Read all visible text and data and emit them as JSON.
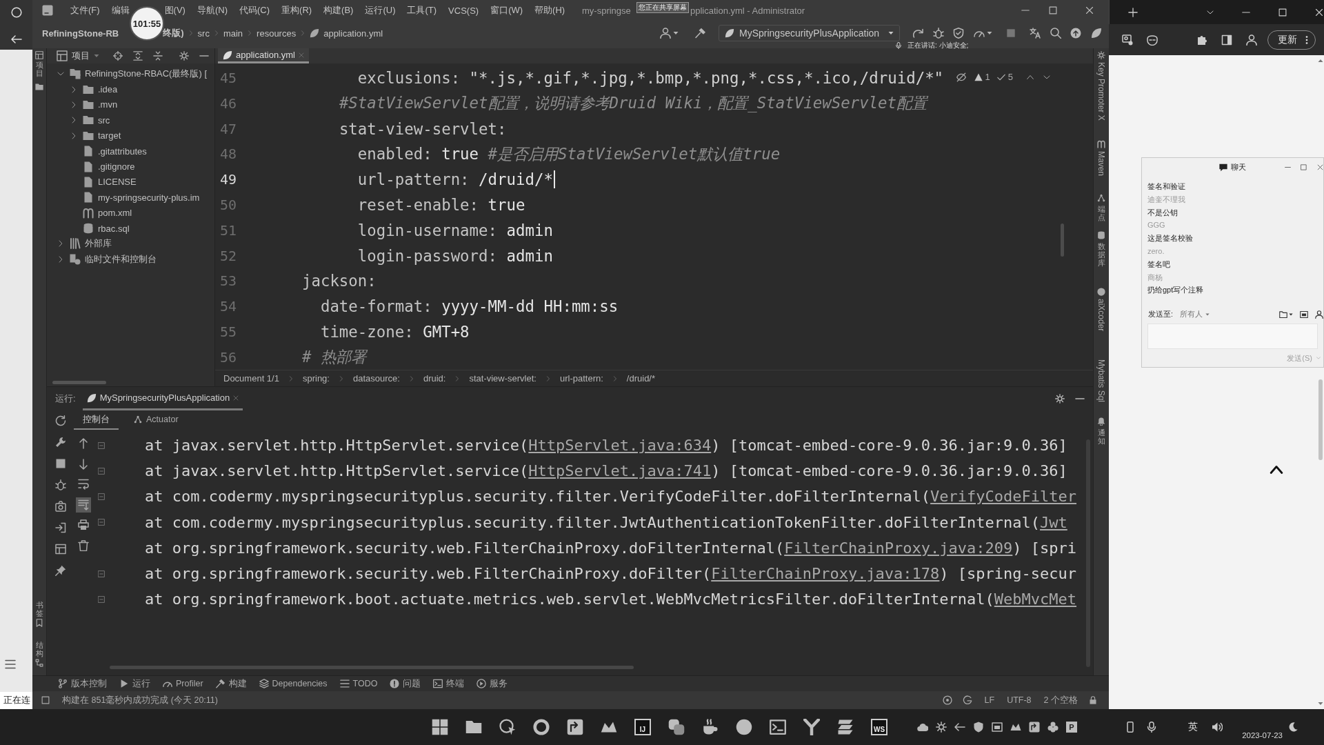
{
  "overlays": {
    "recording_timer": "101:55",
    "share_notice": "您正在共享屏幕",
    "speaking": "正在讲话: 小迪安全;"
  },
  "side_window": {
    "status": "正在连"
  },
  "ide": {
    "menu": [
      "文件(F)",
      "编辑",
      "图(V)",
      "导航(N)",
      "代码(C)",
      "重构(R)",
      "构建(B)",
      "运行(U)",
      "工具(T)",
      "VCS(S)",
      "窗口(W)",
      "帮助(H)"
    ],
    "title": [
      "my-springse",
      "pplication.yml - Administrator"
    ],
    "breadcrumbs": [
      "RefiningStone-RB",
      "终版)",
      "src",
      "main",
      "resources",
      "application.yml"
    ],
    "run_config": "MySpringsecurityPlusApplication",
    "left_strip": {
      "top": "项目",
      "bottom": [
        "书签",
        "结构"
      ]
    },
    "right_strip": [
      "Key Promoter X",
      "Maven",
      "端点",
      "数据库",
      "aiXcoder",
      "Mybatis Sql",
      "通知"
    ],
    "project": {
      "title": "项目",
      "tree": [
        {
          "label": "RefiningStone-RBAC(最终版) [",
          "kind": "module",
          "expanded": true,
          "children": [
            {
              "label": ".idea",
              "kind": "folder",
              "expanded": false
            },
            {
              "label": ".mvn",
              "kind": "folder",
              "expanded": false
            },
            {
              "label": "src",
              "kind": "folder",
              "expanded": false
            },
            {
              "label": "target",
              "kind": "folder",
              "expanded": false
            },
            {
              "label": ".gitattributes",
              "kind": "file"
            },
            {
              "label": ".gitignore",
              "kind": "file"
            },
            {
              "label": "LICENSE",
              "kind": "file"
            },
            {
              "label": "my-springsecurity-plus.im",
              "kind": "file"
            },
            {
              "label": "pom.xml",
              "kind": "maven"
            },
            {
              "label": "rbac.sql",
              "kind": "sql"
            }
          ]
        },
        {
          "label": "外部库",
          "kind": "library",
          "expanded": false
        },
        {
          "label": "临时文件和控制台",
          "kind": "scratch",
          "expanded": false
        }
      ]
    },
    "editor": {
      "tabs": [
        {
          "label": "application.yml",
          "selected": true
        }
      ],
      "inspections": {
        "warnings": "1",
        "checks": "5"
      },
      "lines": [
        {
          "number": "45",
          "current": false,
          "segs": [
            {
              "kind": "key",
              "text": "        exclusions:"
            },
            {
              "kind": "string",
              "text": " \"*.js,*.gif,*.jpg,*.bmp,*.png,*.css,*.ico,/druid/*\""
            }
          ]
        },
        {
          "number": "46",
          "current": false,
          "segs": [
            {
              "kind": "comment",
              "text": "      #StatViewServlet配置，说明请参考Druid Wiki，配置_StatViewServlet配置"
            }
          ]
        },
        {
          "number": "47",
          "current": false,
          "segs": [
            {
              "kind": "key",
              "text": "      stat-view-servlet:"
            }
          ]
        },
        {
          "number": "48",
          "current": false,
          "segs": [
            {
              "kind": "key",
              "text": "        enabled:"
            },
            {
              "kind": "value",
              "text": " true "
            },
            {
              "kind": "comment",
              "text": "#是否启用StatViewServlet默认值true"
            }
          ]
        },
        {
          "number": "49",
          "current": true,
          "segs": [
            {
              "kind": "key",
              "text": "        url-pattern:"
            },
            {
              "kind": "value",
              "text": " /druid/*"
            }
          ]
        },
        {
          "number": "50",
          "current": false,
          "segs": [
            {
              "kind": "key",
              "text": "        reset-enable:"
            },
            {
              "kind": "value",
              "text": " true"
            }
          ]
        },
        {
          "number": "51",
          "current": false,
          "segs": [
            {
              "kind": "key",
              "text": "        login-username:"
            },
            {
              "kind": "value",
              "text": " admin"
            }
          ]
        },
        {
          "number": "52",
          "current": false,
          "segs": [
            {
              "kind": "key",
              "text": "        login-password:"
            },
            {
              "kind": "value",
              "text": " admin"
            }
          ]
        },
        {
          "number": "53",
          "current": false,
          "segs": [
            {
              "kind": "key",
              "text": "  jackson:"
            }
          ]
        },
        {
          "number": "54",
          "current": false,
          "segs": [
            {
              "kind": "key",
              "text": "    date-format:"
            },
            {
              "kind": "value",
              "text": " yyyy-MM-dd HH:mm:ss"
            }
          ]
        },
        {
          "number": "55",
          "current": false,
          "segs": [
            {
              "kind": "key",
              "text": "    time-zone:"
            },
            {
              "kind": "value",
              "text": " GMT+8"
            }
          ]
        },
        {
          "number": "56",
          "current": false,
          "segs": [
            {
              "kind": "comment",
              "text": "  # 热部署"
            }
          ]
        }
      ],
      "path": [
        "Document 1/1",
        "spring:",
        "datasource:",
        "druid:",
        "stat-view-servlet:",
        "url-pattern:",
        "/druid/*"
      ]
    },
    "run": {
      "label": "运行:",
      "tabs": [
        {
          "label": "MySpringsecurityPlusApplication",
          "selected": true
        }
      ],
      "subtabs": [
        {
          "label": "控制台",
          "selected": true
        },
        {
          "label": "Actuator",
          "selected": false
        }
      ],
      "scroll_to_end": true,
      "console": [
        {
          "prefix": "at javax.servlet.http.HttpServlet.service(",
          "link": "HttpServlet.java:634",
          "suffix": ") [tomcat-embed-core-9.0.36.jar:9.0.36]",
          "marker": true
        },
        {
          "prefix": "at javax.servlet.http.HttpServlet.service(",
          "link": "HttpServlet.java:741",
          "suffix": ") [tomcat-embed-core-9.0.36.jar:9.0.36]",
          "marker": true
        },
        {
          "prefix": "at com.codermy.myspringsecurityplus.security.filter.VerifyCodeFilter.doFilterInternal(",
          "link": "VerifyCodeFilter",
          "marker": true
        },
        {
          "prefix": "at com.codermy.myspringsecurityplus.security.filter.JwtAuthenticationTokenFilter.doFilterInternal(",
          "link": "Jwt",
          "marker": true
        },
        {
          "prefix": "at org.springframework.security.web.FilterChainProxy.doFilterInternal(",
          "link": "FilterChainProxy.java:209",
          "suffix": ") [spri",
          "marker": false
        },
        {
          "prefix": "at org.springframework.security.web.FilterChainProxy.doFilter(",
          "link": "FilterChainProxy.java:178",
          "suffix": ") [spring-secur",
          "marker": true
        },
        {
          "prefix": "at org.springframework.boot.actuate.metrics.web.servlet.WebMvcMetricsFilter.doFilterInternal(",
          "link": "WebMvcMet",
          "marker": true
        }
      ]
    },
    "tool_windows": [
      "版本控制",
      "运行",
      "Profiler",
      "构建",
      "Dependencies",
      "TODO",
      "问题",
      "终端",
      "服务"
    ],
    "status": {
      "message": "构建在 851毫秒内成功完成 (今天 20:11)",
      "items": [
        "LF",
        "UTF-8",
        "2 个空格"
      ]
    }
  },
  "browser": {
    "update_button": "更新"
  },
  "chat": {
    "title": "聊天",
    "lines": [
      {
        "kind": "message",
        "text": "签名和验证"
      },
      {
        "kind": "sender",
        "text": "迪奎不理我"
      },
      {
        "kind": "message",
        "text": "不是公钥"
      },
      {
        "kind": "sender",
        "text": "GGG"
      },
      {
        "kind": "message",
        "text": "这是签名校验"
      },
      {
        "kind": "sender",
        "text": "zero."
      },
      {
        "kind": "message",
        "text": "签名吧"
      },
      {
        "kind": "sender",
        "text": "商杨"
      },
      {
        "kind": "message",
        "text": "扔给gpt写个注释"
      }
    ],
    "send_to_label": "发送至:",
    "recipient": "所有人",
    "send_button": {
      "label": "发送(S)",
      "disabled": true
    }
  },
  "taskbar": {
    "app_letters": [
      "IJ",
      "WS"
    ],
    "tray_letter": "P",
    "input_method": "英",
    "date": "2023-07-23"
  }
}
